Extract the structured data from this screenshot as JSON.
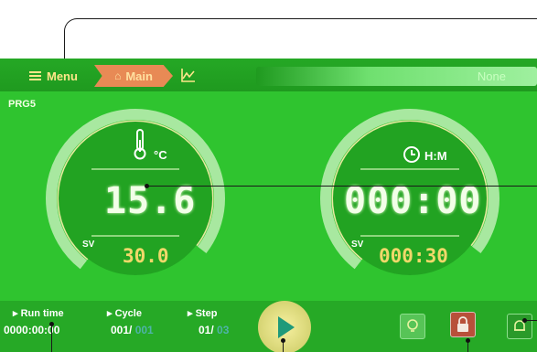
{
  "topbar": {
    "menu_label": "Menu",
    "main_label": "Main",
    "status_value": "None"
  },
  "program": {
    "name": "PRG5"
  },
  "temperature": {
    "unit": "°C",
    "pv": "15.6",
    "sv_label": "SV",
    "sv": "30.0"
  },
  "time": {
    "unit": "H:M",
    "pv": "000:00",
    "sv_label": "SV",
    "sv": "000:30"
  },
  "bottombar": {
    "runtime_label": "Run time",
    "runtime_value": "0000:00:00",
    "cycle_label": "Cycle",
    "cycle_current": "001",
    "cycle_total": "001",
    "step_label": "Step",
    "step_current": "01",
    "step_total": "03"
  },
  "colors": {
    "screen_bg": "#2fc42f",
    "accent_yellow": "#f0d86a",
    "main_tab": "#e88a55",
    "lock_button": "#b8503a"
  },
  "icons": [
    "menu-icon",
    "home-icon",
    "trend-icon",
    "thermometer-icon",
    "clock-icon",
    "play-icon",
    "bulb-icon",
    "lock-icon",
    "alarm-bell-icon"
  ]
}
